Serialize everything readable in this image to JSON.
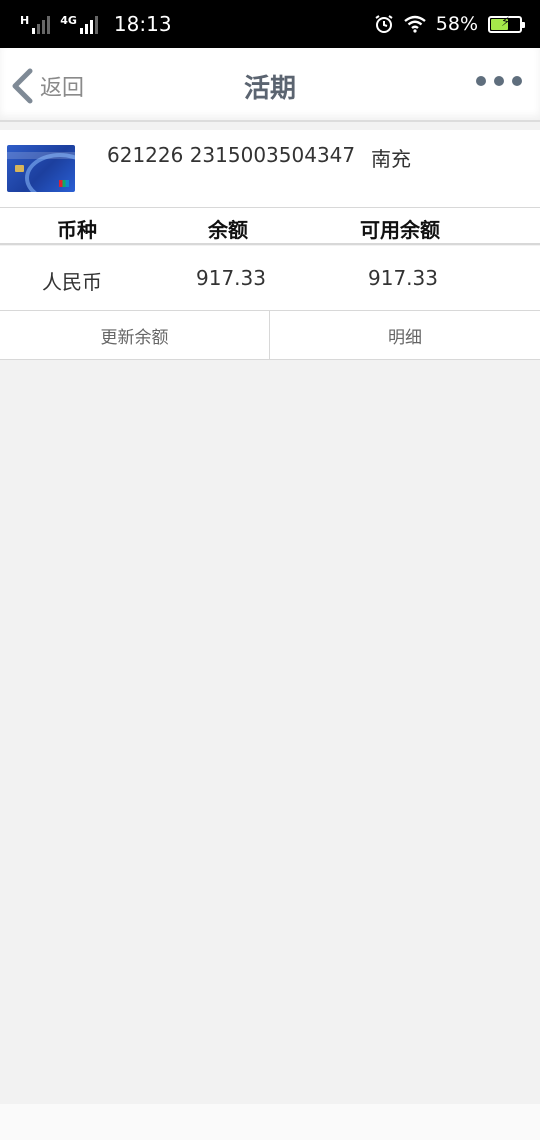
{
  "status_bar": {
    "network_label_1": "H",
    "network_label_2": "4G",
    "time": "18:13",
    "battery": "58%",
    "icons": [
      "signal-icon",
      "alarm-icon",
      "wifi-icon",
      "battery-charging-icon"
    ]
  },
  "nav": {
    "back_label": "返回",
    "title": "活期",
    "more_icon": "more-dots-icon"
  },
  "account": {
    "card_number": "621226 2315003504347",
    "branch": "南充"
  },
  "balance_table": {
    "headers": [
      "币种",
      "余额",
      "可用余额"
    ],
    "rows": [
      [
        "人民币",
        "917.33",
        "917.33"
      ]
    ]
  },
  "actions": {
    "refresh_label": "更新余额",
    "detail_label": "明细"
  },
  "colors": {
    "status_bar_bg": "#000000",
    "nav_title": "#5b6470",
    "page_bg": "#f2f2f2",
    "battery_fill": "#a5e84a"
  }
}
